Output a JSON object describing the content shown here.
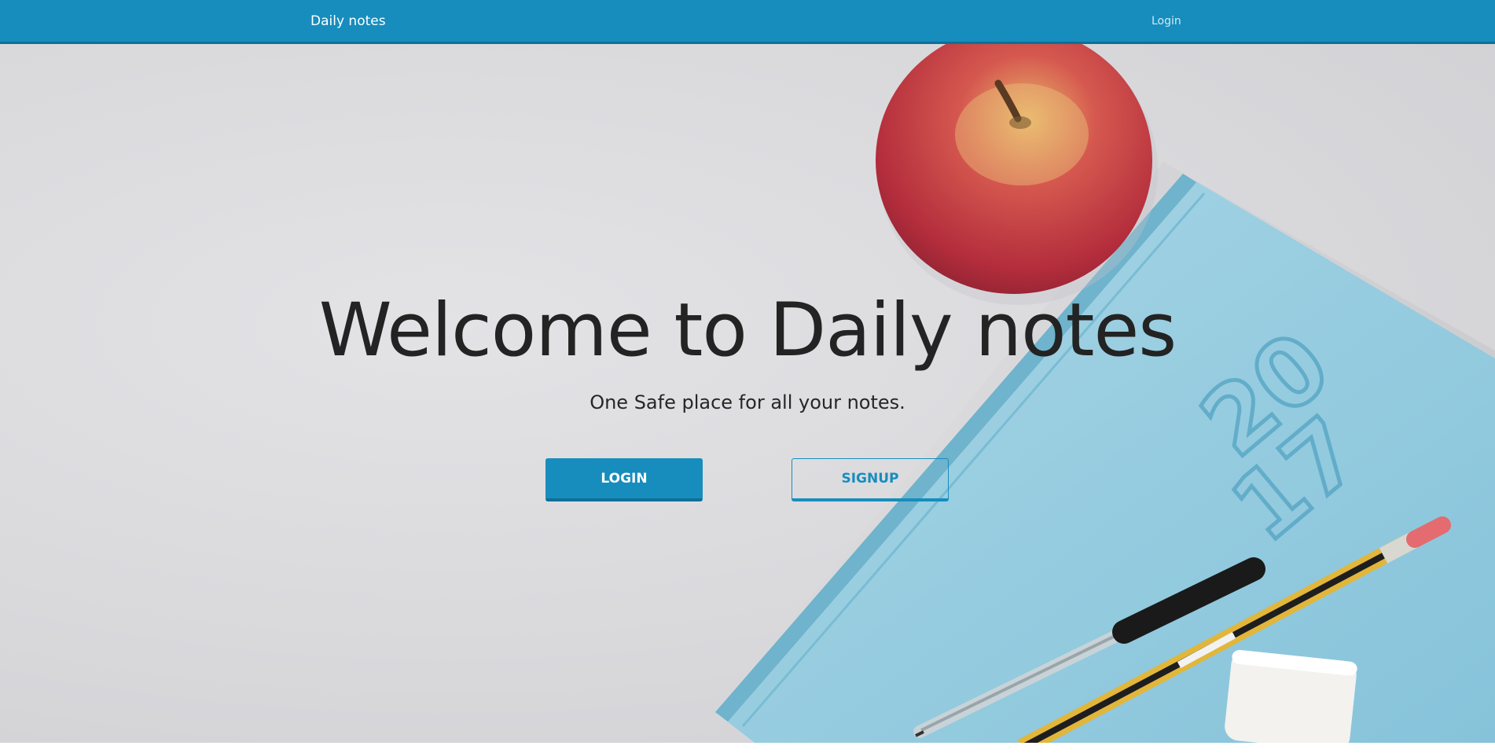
{
  "navbar": {
    "brand": "Daily notes",
    "login_link": "Login"
  },
  "hero": {
    "title": "Welcome to Daily notes",
    "subtitle": "One Safe place for all your notes.",
    "login_button": "LOGIN",
    "signup_button": "SIGNUP",
    "background_image": "desk photo with apple, light-blue 2017 notebook, pen, pencil and eraser",
    "notebook_year": "2017"
  },
  "colors": {
    "primary": "#178dbd",
    "primary_dark": "#0f6f97",
    "text_dark": "#232323"
  }
}
